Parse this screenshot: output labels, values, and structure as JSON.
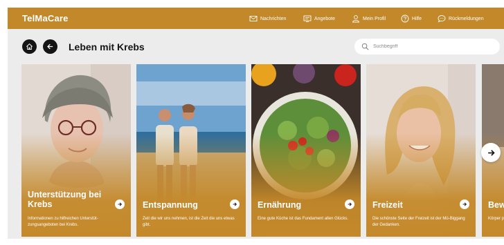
{
  "brand": "TelMaCare",
  "nav": {
    "messages": "Nachrichten",
    "offers": "Angebote",
    "profile": "Mein Profil",
    "help": "Hilfe",
    "feedback": "Rückmeldungen"
  },
  "page": {
    "title": "Leben mit Krebs"
  },
  "search": {
    "placeholder": "Suchbegriff"
  },
  "cards": [
    {
      "title": "Unterstützung bei Krebs",
      "desc": "Informationen zu hilfreichen Unterstüt-zungsangeboten bei Krebs."
    },
    {
      "title": "Entspannung",
      "desc": "Zeit die wir uns nehmen, ist die Zeit die uns etwas gibt."
    },
    {
      "title": "Ernährung",
      "desc": "Eine gute Küche ist das Fundament allen Glücks."
    },
    {
      "title": "Freizeit",
      "desc": "Die schönste Seite der Freizeit ist der Mü-Biggang der Gedanken."
    },
    {
      "title": "Bew",
      "desc": "Körper pie bei"
    }
  ],
  "colors": {
    "accent": "#c3882a",
    "background": "#ececec",
    "button_dark": "#151515"
  }
}
